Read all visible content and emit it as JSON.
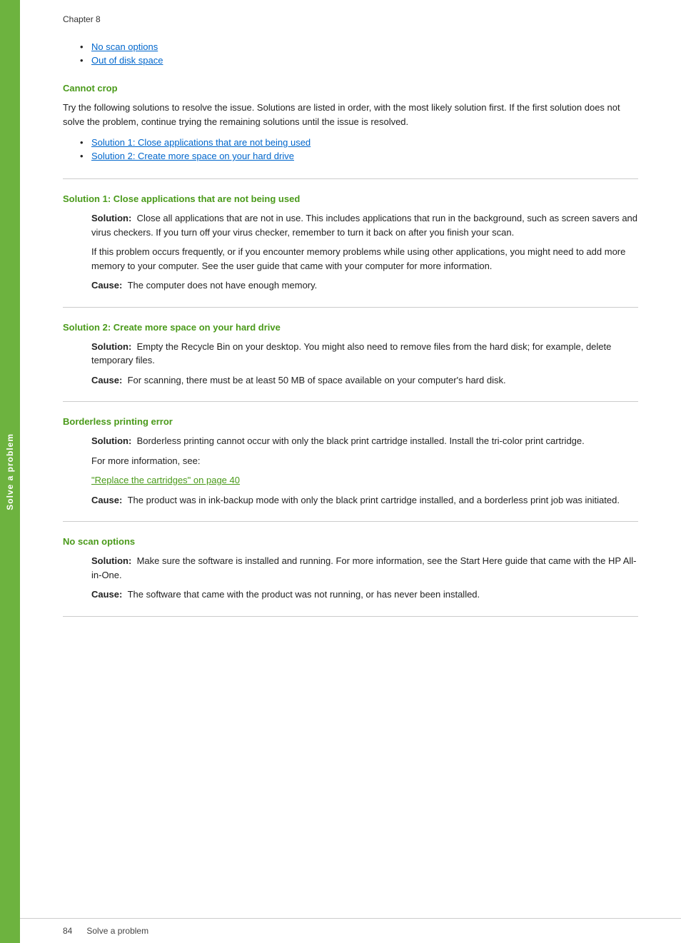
{
  "sidebar": {
    "label": "Solve a problem"
  },
  "chapter": {
    "label": "Chapter 8"
  },
  "toc_links": [
    {
      "text": "No scan options",
      "href": "#no-scan-options"
    },
    {
      "text": "Out of disk space",
      "href": "#out-of-disk-space"
    }
  ],
  "cannot_crop": {
    "title": "Cannot crop",
    "intro": "Try the following solutions to resolve the issue. Solutions are listed in order, with the most likely solution first. If the first solution does not solve the problem, continue trying the remaining solutions until the issue is resolved.",
    "links": [
      {
        "text": "Solution 1: Close applications that are not being used",
        "href": "#sol1"
      },
      {
        "text": "Solution 2: Create more space on your hard drive",
        "href": "#sol2"
      }
    ]
  },
  "solution1": {
    "title": "Solution 1: Close applications that are not being used",
    "solution_label": "Solution:",
    "solution_text": "Close all applications that are not in use. This includes applications that run in the background, such as screen savers and virus checkers. If you turn off your virus checker, remember to turn it back on after you finish your scan.",
    "solution_text2": "If this problem occurs frequently, or if you encounter memory problems while using other applications, you might need to add more memory to your computer. See the user guide that came with your computer for more information.",
    "cause_label": "Cause:",
    "cause_text": "The computer does not have enough memory."
  },
  "solution2": {
    "title": "Solution 2: Create more space on your hard drive",
    "solution_label": "Solution:",
    "solution_text": "Empty the Recycle Bin on your desktop. You might also need to remove files from the hard disk; for example, delete temporary files.",
    "cause_label": "Cause:",
    "cause_text": "For scanning, there must be at least 50 MB of space available on your computer's hard disk."
  },
  "borderless": {
    "title": "Borderless printing error",
    "solution_label": "Solution:",
    "solution_text": "Borderless printing cannot occur with only the black print cartridge installed. Install the tri-color print cartridge.",
    "more_info": "For more information, see:",
    "link_text": "\"Replace the cartridges\" on page 40",
    "cause_label": "Cause:",
    "cause_text": "The product was in ink-backup mode with only the black print cartridge installed, and a borderless print job was initiated."
  },
  "no_scan_options": {
    "title": "No scan options",
    "solution_label": "Solution:",
    "solution_text": "Make sure the software is installed and running. For more information, see the Start Here guide that came with the HP All-in-One.",
    "cause_label": "Cause:",
    "cause_text": "The software that came with the product was not running, or has never been installed."
  },
  "footer": {
    "page_number": "84",
    "title": "Solve a problem"
  }
}
